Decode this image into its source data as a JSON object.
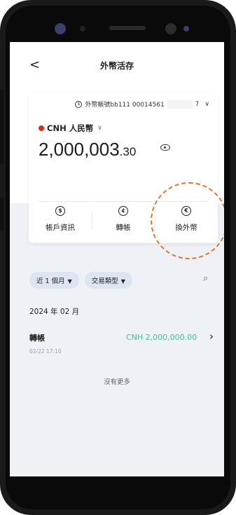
{
  "header": {
    "back_label": "<",
    "title": "外幣活存"
  },
  "account": {
    "label": "外幣帳號bb111 00014561",
    "tail": "7",
    "icon": "coin-icon"
  },
  "currency": {
    "label": "CNH 人民幣",
    "flag_color": "#e02a20"
  },
  "balance": {
    "integer": "2,000,003",
    "decimal": ".30"
  },
  "actions": [
    {
      "label": "帳戶資訊",
      "icon": "account-info-icon"
    },
    {
      "label": "轉帳",
      "icon": "transfer-icon"
    },
    {
      "label": "換外幣",
      "icon": "exchange-icon"
    }
  ],
  "filters": [
    {
      "label": "近 1 個月"
    },
    {
      "label": "交易類型"
    }
  ],
  "month_label": "2024 年 02 月",
  "transactions": [
    {
      "title": "轉帳",
      "date": "02/22 17:10",
      "amount": "CNH 2,000,000.00"
    }
  ],
  "no_more_label": "沒有更多",
  "colors": {
    "accent_green": "#3ec39a",
    "highlight_orange": "#e2772e",
    "pill_bg": "#dde5f2"
  }
}
